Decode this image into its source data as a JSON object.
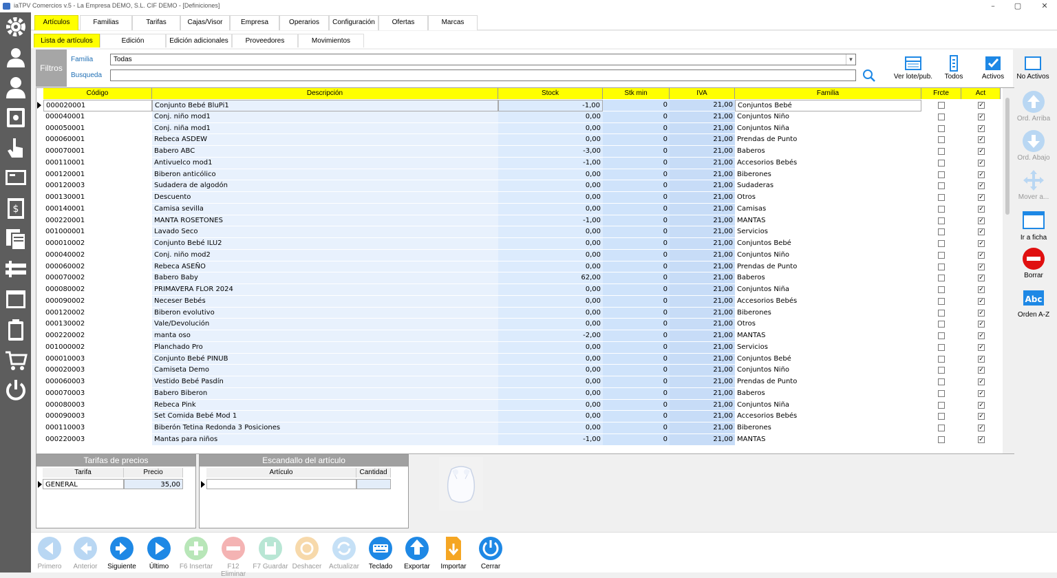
{
  "window": {
    "title": "iaTPV Comercios v.5 - La Empresa DEMO, S.L. CIF DEMO - [Definiciones]",
    "minimize": "–",
    "maximize": "▢",
    "close": "✕"
  },
  "leftbar": {
    "items": [
      "gear-icon",
      "user-icon",
      "user-dark-icon",
      "safe-icon",
      "hand-pointer-icon",
      "monitor-icon",
      "cash-register-icon",
      "documents-icon",
      "tools-icon",
      "window-icon",
      "clipboard-icon",
      "cart-icon",
      "power-icon"
    ]
  },
  "topmenu": [
    {
      "label": "Artículos",
      "active": true
    },
    {
      "label": "Familias"
    },
    {
      "label": "Tarifas"
    },
    {
      "label": "Cajas/Visor"
    },
    {
      "label": "Empresa"
    },
    {
      "label": "Operarios"
    },
    {
      "label": "Configuración"
    },
    {
      "label": "Ofertas"
    },
    {
      "label": "Marcas"
    }
  ],
  "submenu": [
    {
      "label": "Lista de artículos",
      "active": true
    },
    {
      "label": "Edición"
    },
    {
      "label": "Edición adicionales"
    },
    {
      "label": "Proveedores"
    },
    {
      "label": "Movimientos"
    }
  ],
  "filters": {
    "title": "Filtros",
    "familia_label": "Familia",
    "familia_value": "Todas",
    "busqueda_label": "Busqueda",
    "busqueda_value": ""
  },
  "toolbar": {
    "ver_lote": "Ver lote/pub.",
    "todos": "Todos",
    "activos": "Activos",
    "no_activos": "No Activos"
  },
  "grid": {
    "columns": [
      "Código",
      "Descripción",
      "Stock",
      "Stk min",
      "IVA",
      "Familia",
      "Frcte",
      "Act"
    ],
    "rows": [
      [
        "000020001",
        "Conjunto Bebé BluPi1",
        "-1,00",
        "0",
        "21,00",
        "Conjuntos Bebé"
      ],
      [
        "000040001",
        "Conj. niño mod1",
        "0,00",
        "0",
        "21,00",
        "Conjuntos Niño"
      ],
      [
        "000050001",
        "Conj. niña mod1",
        "0,00",
        "0",
        "21,00",
        "Conjuntos Niña"
      ],
      [
        "000060001",
        "Rebeca ASDEW",
        "0,00",
        "0",
        "21,00",
        "Prendas de Punto"
      ],
      [
        "000070001",
        "Babero ABC",
        "-3,00",
        "0",
        "21,00",
        "Baberos"
      ],
      [
        "000110001",
        "Antivuelco mod1",
        "-1,00",
        "0",
        "21,00",
        "Accesorios Bebés"
      ],
      [
        "000120001",
        "Biberon anticólico",
        "0,00",
        "0",
        "21,00",
        "Biberones"
      ],
      [
        "000120003",
        "Sudadera de algodón",
        "0,00",
        "0",
        "21,00",
        "Sudaderas"
      ],
      [
        "000130001",
        "Descuento",
        "0,00",
        "0",
        "21,00",
        "Otros"
      ],
      [
        "000140001",
        "Camisa sevilla",
        "0,00",
        "0",
        "21,00",
        "Camisas"
      ],
      [
        "000220001",
        "MANTA ROSETONES",
        "-1,00",
        "0",
        "21,00",
        "MANTAS"
      ],
      [
        "001000001",
        "Lavado Seco",
        "0,00",
        "0",
        "21,00",
        "Servicios"
      ],
      [
        "000010002",
        "Conjunto Bebé ILU2",
        "0,00",
        "0",
        "21,00",
        "Conjuntos Bebé"
      ],
      [
        "000040002",
        "Conj. niño mod2",
        "0,00",
        "0",
        "21,00",
        "Conjuntos Niño"
      ],
      [
        "000060002",
        "Rebeca ASEÑO",
        "0,00",
        "0",
        "21,00",
        "Prendas de Punto"
      ],
      [
        "000070002",
        "Babero Baby",
        "62,00",
        "0",
        "21,00",
        "Baberos"
      ],
      [
        "000080002",
        "PRIMAVERA FLOR 2024",
        "0,00",
        "0",
        "21,00",
        "Conjuntos Niña"
      ],
      [
        "000090002",
        "Neceser Bebés",
        "0,00",
        "0",
        "21,00",
        "Accesorios Bebés"
      ],
      [
        "000120002",
        "Biberon evolutivo",
        "0,00",
        "0",
        "21,00",
        "Biberones"
      ],
      [
        "000130002",
        "Vale/Devolución",
        "0,00",
        "0",
        "21,00",
        "Otros"
      ],
      [
        "000220002",
        "manta oso",
        "-2,00",
        "0",
        "21,00",
        "MANTAS"
      ],
      [
        "001000002",
        "Planchado Pro",
        "0,00",
        "0",
        "21,00",
        "Servicios"
      ],
      [
        "000010003",
        "Conjunto Bebé PINUB",
        "0,00",
        "0",
        "21,00",
        "Conjuntos Bebé"
      ],
      [
        "000020003",
        "Camiseta Demo",
        "0,00",
        "0",
        "21,00",
        "Conjuntos Niño"
      ],
      [
        "000060003",
        "Vestido Bebé Pasdín",
        "0,00",
        "0",
        "21,00",
        "Prendas de Punto"
      ],
      [
        "000070003",
        "Babero Biberon",
        "0,00",
        "0",
        "21,00",
        "Baberos"
      ],
      [
        "000080003",
        "Rebeca Pink",
        "0,00",
        "0",
        "21,00",
        "Conjuntos Niña"
      ],
      [
        "000090003",
        "Set Comida Bebé Mod 1",
        "0,00",
        "0",
        "21,00",
        "Accesorios Bebés"
      ],
      [
        "000110003",
        "Biberón Tetina Redonda 3 Posiciones",
        "0,00",
        "0",
        "21,00",
        "Biberones"
      ],
      [
        "000220003",
        "Mantas para niños",
        "-1,00",
        "0",
        "21,00",
        "MANTAS"
      ]
    ]
  },
  "sidebuttons": {
    "ord_arriba": "Ord. Arriba",
    "ord_abajo": "Ord. Abajo",
    "mover": "Mover a...",
    "ir_ficha": "Ir a ficha",
    "borrar": "Borrar",
    "orden_az": "Orden A-Z",
    "abc": "Abc"
  },
  "tarifas": {
    "title": "Tarifas de precios",
    "col_tarifa": "Tarifa",
    "col_precio": "Precio",
    "tarifa": "GENERAL",
    "precio": "35,00"
  },
  "escandallo": {
    "title": "Escandallo del artículo",
    "col_articulo": "Artículo",
    "col_cantidad": "Cantidad"
  },
  "bottom": {
    "primero": "Primero",
    "anterior": "Anterior",
    "siguiente": "Siguiente",
    "ultimo": "Último",
    "insertar": "F6 Insertar",
    "eliminar": "F12 Eliminar",
    "guardar": "F7 Guardar",
    "deshacer": "Deshacer",
    "actualizar": "Actualizar",
    "teclado": "Teclado",
    "exportar": "Exportar",
    "importar": "Importar",
    "cerrar": "Cerrar"
  },
  "colors": {
    "accent": "#ffff00",
    "blue": "#1e88e5",
    "grey": "#5d5d5d"
  }
}
